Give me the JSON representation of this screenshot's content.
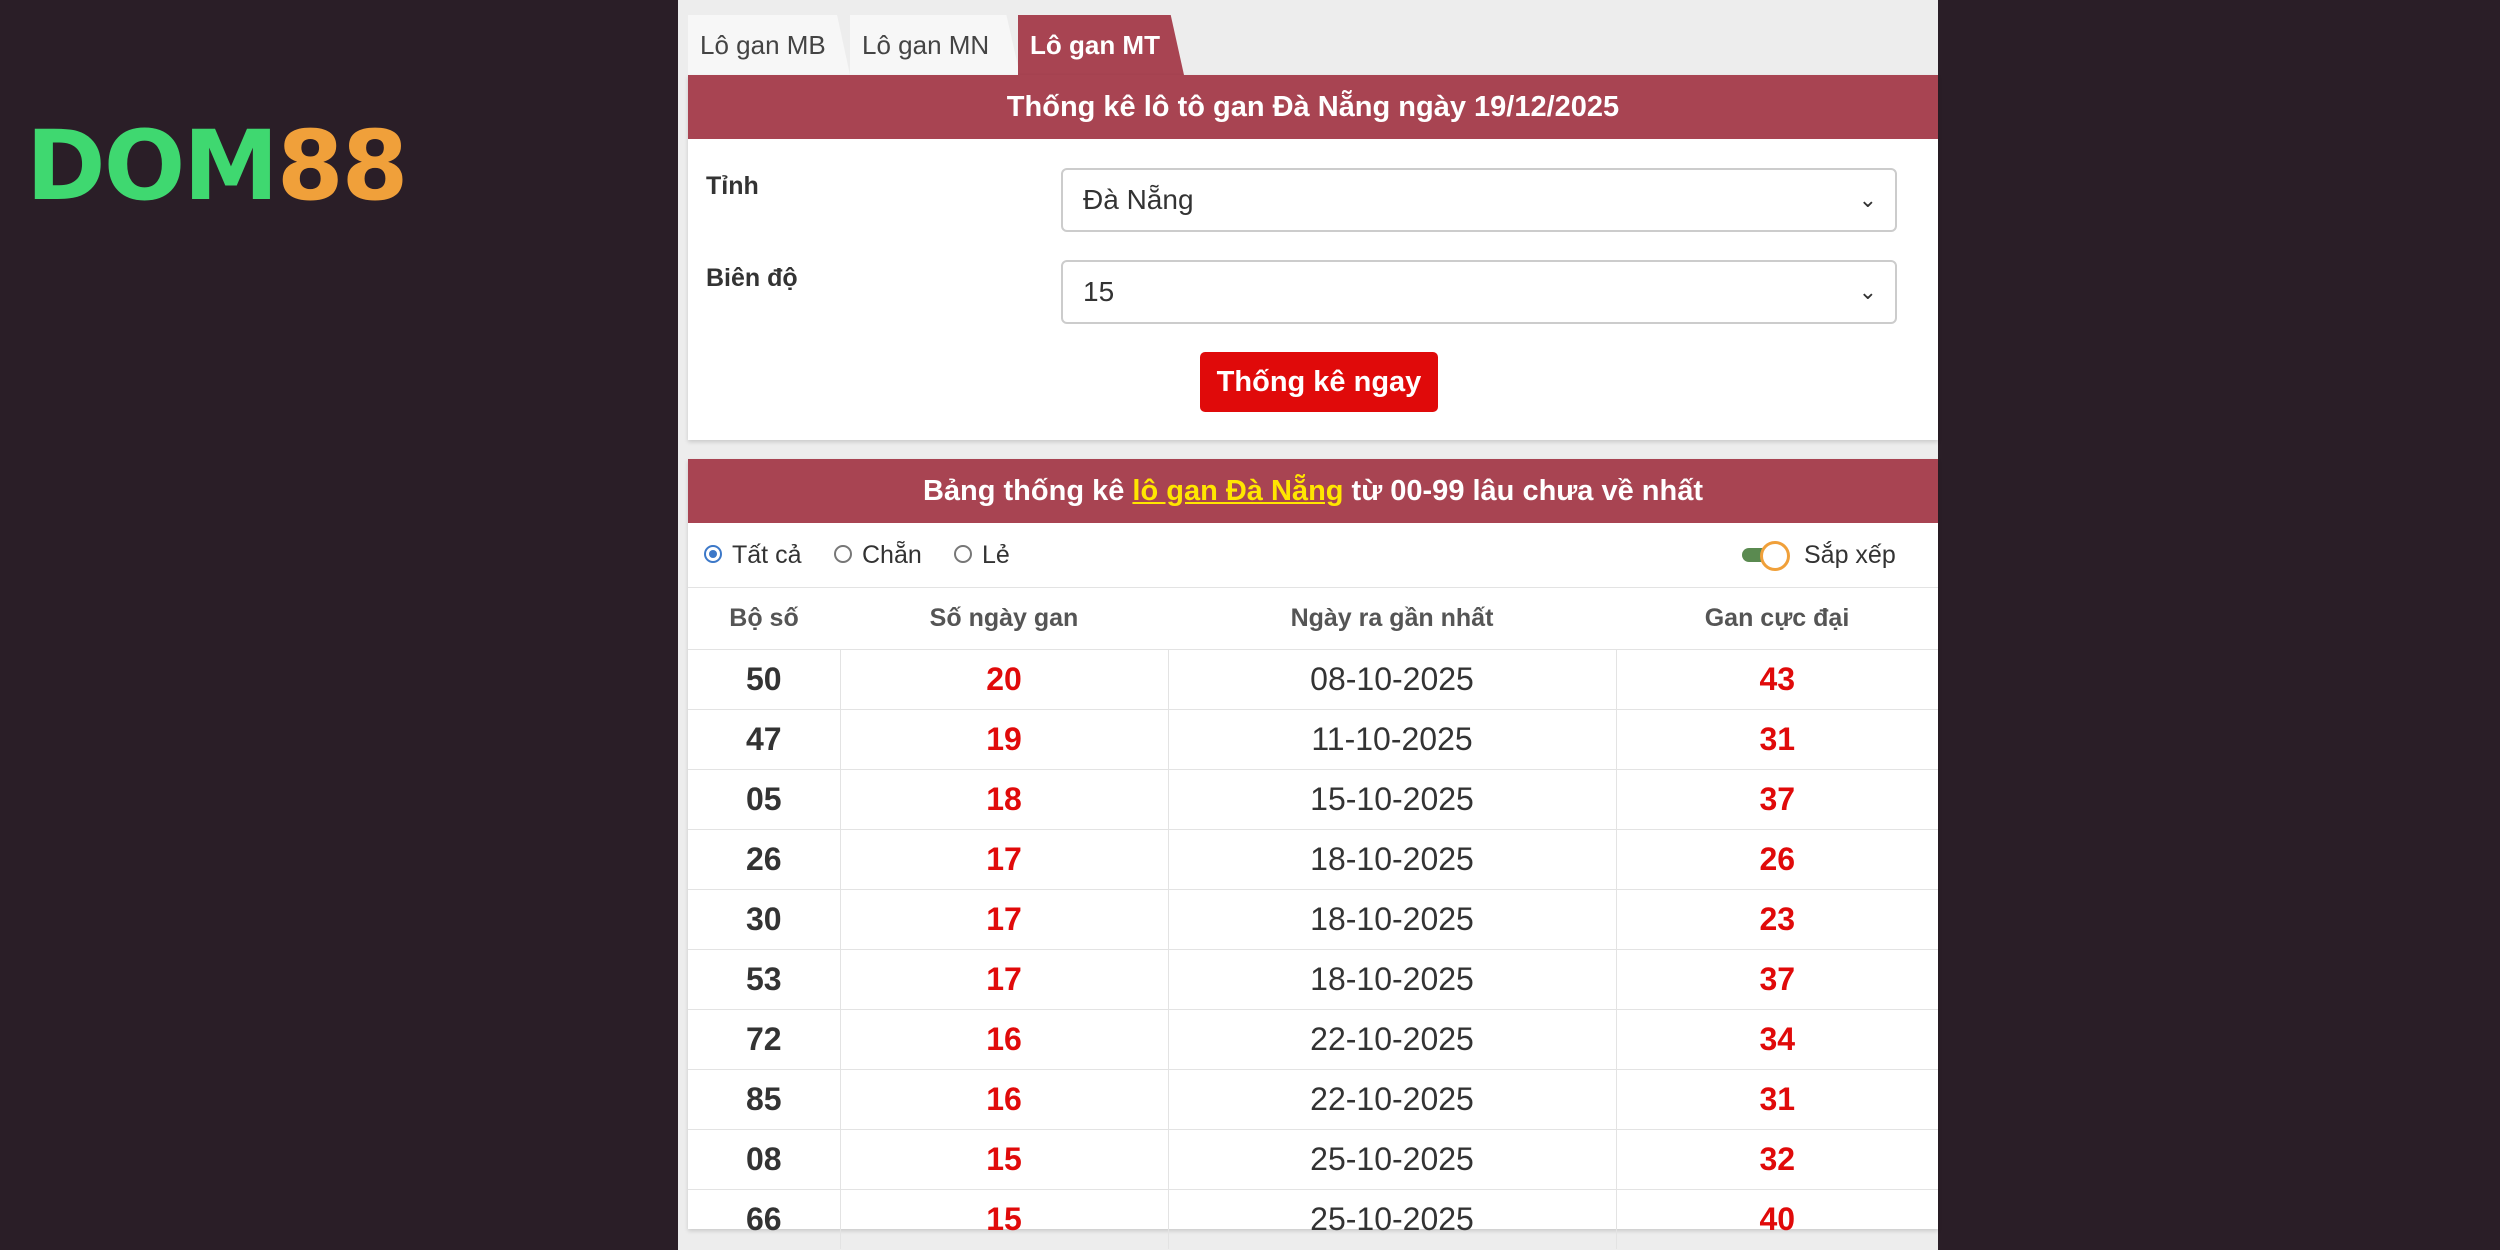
{
  "logo": {
    "part1": "DOM",
    "part2": "88"
  },
  "tabs": [
    {
      "label": "Lô gan MB",
      "active": false
    },
    {
      "label": "Lô gan MN",
      "active": false
    },
    {
      "label": "Lô gan MT",
      "active": true
    }
  ],
  "form": {
    "title": "Thống kê lô tô gan Đà Nẵng ngày 19/12/2025",
    "province_label": "Tỉnh",
    "province_value": "Đà Nẵng",
    "range_label": "Biên độ",
    "range_value": "15",
    "submit_label": "Thống kê ngay"
  },
  "results": {
    "title_before": "Bảng thống kê ",
    "title_link": "lô gan Đà Nẵng",
    "title_after": " từ 00-99 lâu chưa về nhất",
    "filters": [
      {
        "label": "Tất cả",
        "checked": true
      },
      {
        "label": "Chẵn",
        "checked": false
      },
      {
        "label": "Lẻ",
        "checked": false
      }
    ],
    "sort_label": "Sắp xếp",
    "sort_on": true,
    "columns": [
      "Bộ số",
      "Số ngày gan",
      "Ngày ra gần nhất",
      "Gan cực đại"
    ],
    "rows": [
      {
        "number": "50",
        "days": "20",
        "last_date": "08-10-2025",
        "max_gan": "43"
      },
      {
        "number": "47",
        "days": "19",
        "last_date": "11-10-2025",
        "max_gan": "31"
      },
      {
        "number": "05",
        "days": "18",
        "last_date": "15-10-2025",
        "max_gan": "37"
      },
      {
        "number": "26",
        "days": "17",
        "last_date": "18-10-2025",
        "max_gan": "26"
      },
      {
        "number": "30",
        "days": "17",
        "last_date": "18-10-2025",
        "max_gan": "23"
      },
      {
        "number": "53",
        "days": "17",
        "last_date": "18-10-2025",
        "max_gan": "37"
      },
      {
        "number": "72",
        "days": "16",
        "last_date": "22-10-2025",
        "max_gan": "34"
      },
      {
        "number": "85",
        "days": "16",
        "last_date": "22-10-2025",
        "max_gan": "31"
      },
      {
        "number": "08",
        "days": "15",
        "last_date": "25-10-2025",
        "max_gan": "32"
      },
      {
        "number": "66",
        "days": "15",
        "last_date": "25-10-2025",
        "max_gan": "40"
      }
    ]
  },
  "colors": {
    "header_bar": "#a84452",
    "accent_red": "#e00a0a",
    "link_yellow": "#ffe600",
    "logo_green": "#3fd870",
    "logo_orange": "#f0a03a"
  }
}
